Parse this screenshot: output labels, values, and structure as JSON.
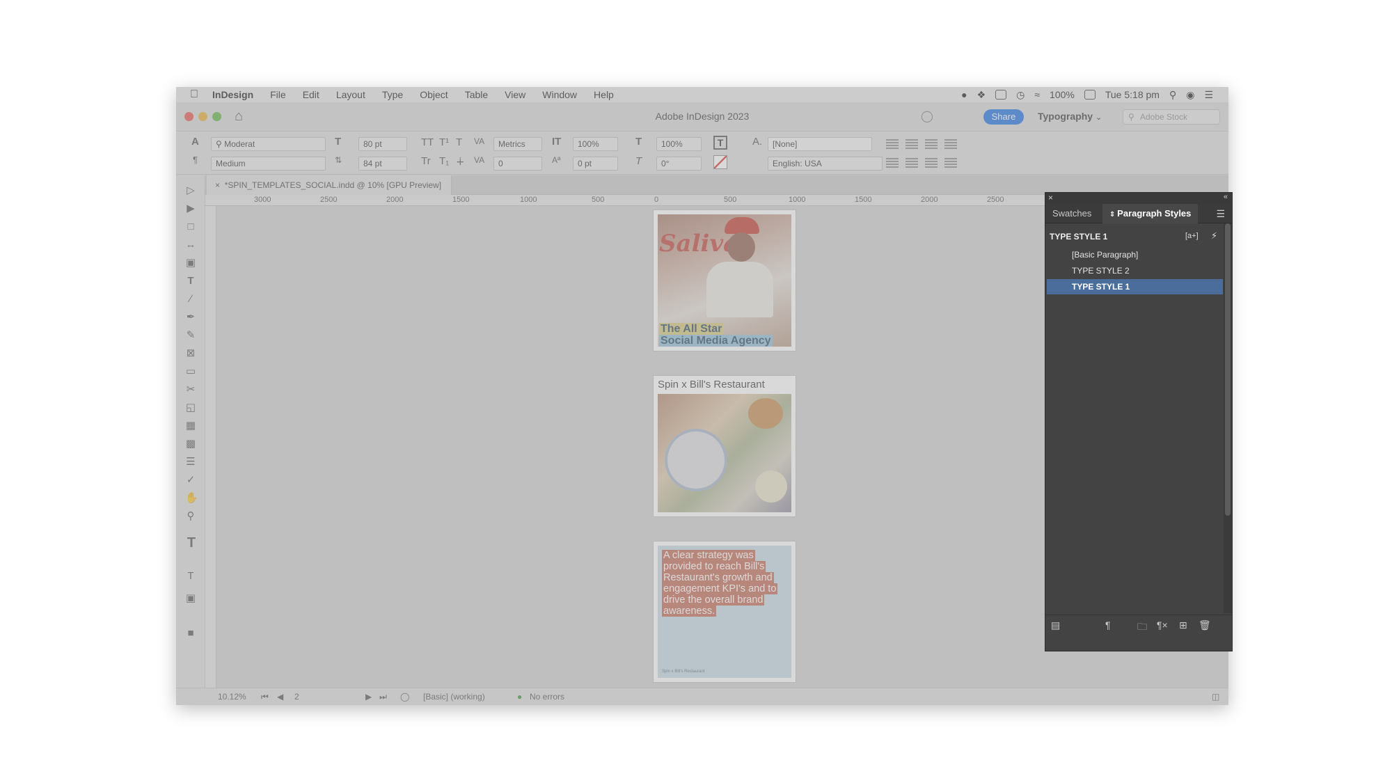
{
  "menubar": {
    "app": "InDesign",
    "items": [
      "File",
      "Edit",
      "Layout",
      "Type",
      "Object",
      "Table",
      "View",
      "Window",
      "Help"
    ],
    "battery": "100%",
    "clock": "Tue 5:18 pm"
  },
  "titlebar": {
    "title": "Adobe InDesign 2023",
    "share_label": "Share",
    "workspace": "Typography",
    "search_placeholder": "Adobe Stock"
  },
  "control": {
    "font_family": "Moderat",
    "font_style": "Medium",
    "font_size": "80 pt",
    "leading": "84 pt",
    "kerning": "Metrics",
    "tracking": "0",
    "vscale": "100%",
    "hscale": "100%",
    "baseline": "0 pt",
    "skew": "0°",
    "char_style": "[None]",
    "language": "English: USA"
  },
  "document": {
    "tab_title": "*SPIN_TEMPLATES_SOCIAL.indd @ 10% [GPU Preview]",
    "ruler_labels": [
      "3000",
      "2500",
      "2000",
      "1500",
      "1000",
      "500",
      "0",
      "500",
      "1000",
      "1500",
      "2000",
      "2500"
    ]
  },
  "pages": {
    "p1_headline_1": "The All Star",
    "p1_headline_2": "Social Media Agency",
    "p2_title": "Spin x Bill's Restaurant",
    "p3_body": "A clear strategy was provided to reach Bill's Restaurant's growth and engagement KPI's and to drive the overall brand awareness.",
    "p3_footer": "Spin x Bill's Restaurant"
  },
  "status": {
    "zoom": "10.12%",
    "page": "2",
    "preflight_profile": "[Basic] (working)",
    "errors": "No errors"
  },
  "panel": {
    "tabs": [
      "Swatches",
      "Paragraph Styles"
    ],
    "current_style": "TYPE STYLE 1",
    "styles": [
      "[Basic Paragraph]",
      "TYPE STYLE 2",
      "TYPE STYLE 1"
    ],
    "selected_index": 2
  }
}
